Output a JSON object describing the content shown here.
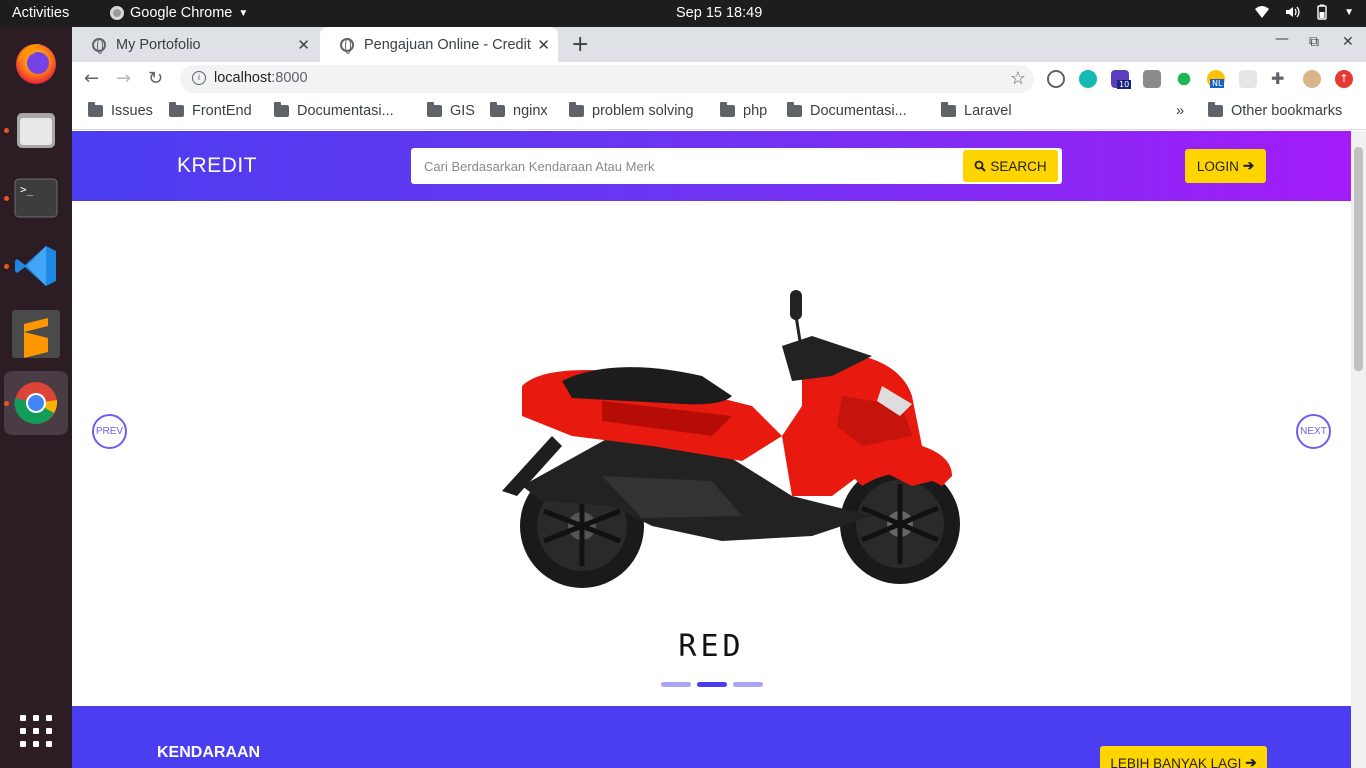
{
  "os": {
    "activities": "Activities",
    "app_name": "Google Chrome",
    "clock": "Sep 15  18:49"
  },
  "browser": {
    "tabs": [
      {
        "title": "My Portofolio"
      },
      {
        "title": "Pengajuan Online - Credit"
      }
    ],
    "url_host": "localhost",
    "url_port": ":8000",
    "bookmarks": [
      "Issues",
      "FrontEnd",
      "Documentasi...",
      "GIS",
      "nginx",
      "problem solving",
      "php",
      "Documentasi...",
      "Laravel"
    ],
    "other_bookmarks": "Other bookmarks",
    "ext_badge_1": "10",
    "ext_badge_2": "NL"
  },
  "site": {
    "brand": "KREDIT",
    "search_placeholder": "Cari Berdasarkan Kendaraan Atau Merk",
    "search_label": "SEARCH",
    "login_label": "LOGIN"
  },
  "carousel": {
    "prev_label": "PREV",
    "next_label": "NEXT",
    "slide_title": "RED",
    "slide_count": 3,
    "active_slide": 2
  },
  "section": {
    "title": "KENDARAAN",
    "more_label": "LEBIH BANYAK LAGI"
  },
  "colors": {
    "brand_primary": "#4b3df0",
    "brand_gradient_end": "#a21cf7",
    "accent_yellow": "#ffd500",
    "scooter_red": "#e8190f"
  }
}
